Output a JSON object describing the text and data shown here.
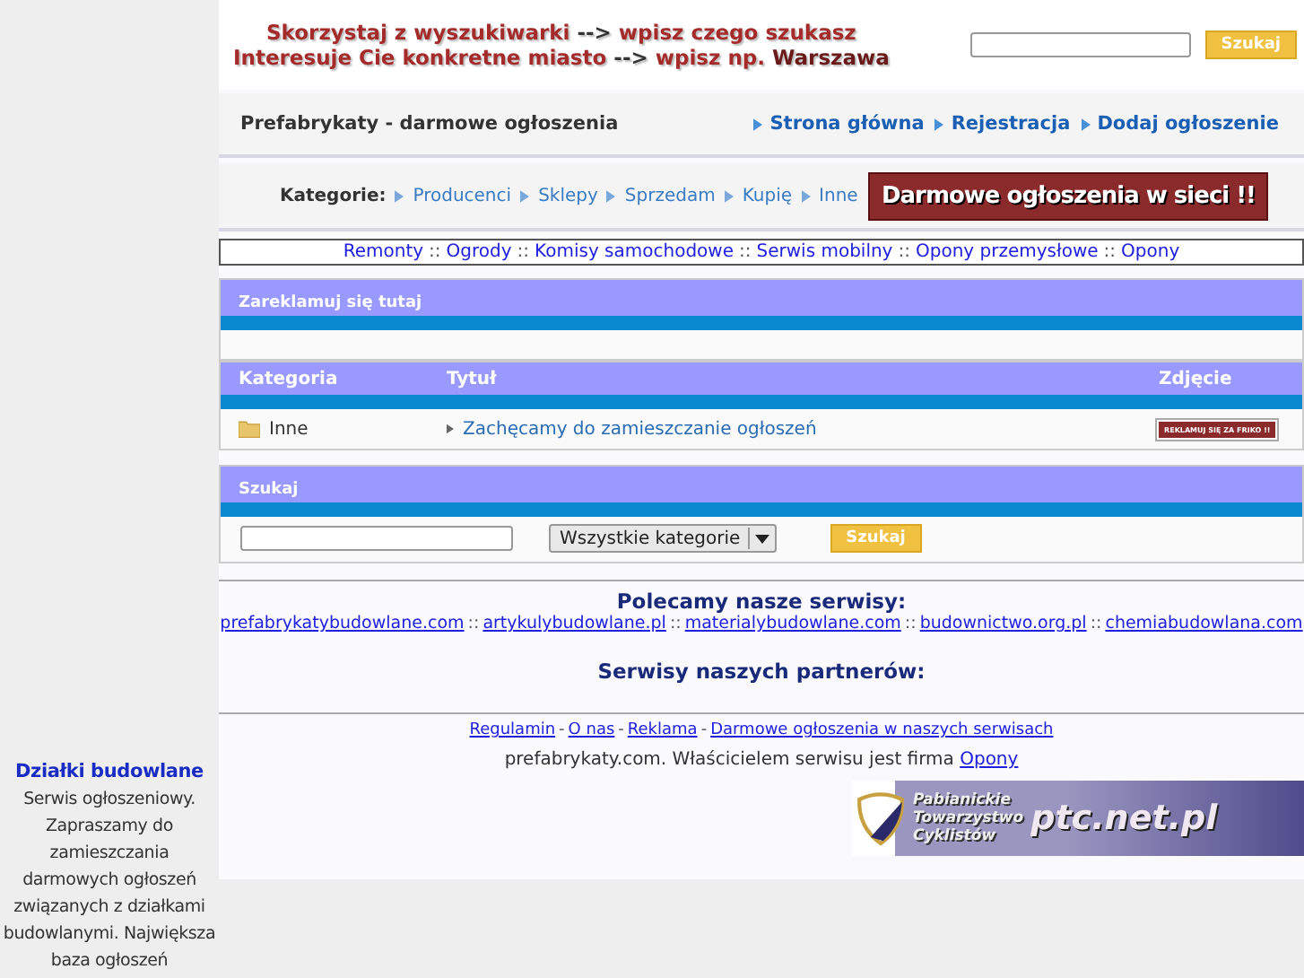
{
  "header": {
    "lines": [
      [
        {
          "text": "Skorzystaj z wyszukiwarki",
          "kind": "red"
        },
        {
          "text": "-->",
          "kind": "dark"
        },
        {
          "text": "wpisz czego szukasz",
          "kind": "red"
        }
      ],
      [
        {
          "text": "Interesuje Cie konkretne miasto",
          "kind": "red"
        },
        {
          "text": "-->",
          "kind": "dark"
        },
        {
          "text": "wpisz np.",
          "kind": "red"
        },
        {
          "text": "Warszawa",
          "kind": "strong"
        }
      ]
    ],
    "search_button": "Szukaj"
  },
  "nav": {
    "title": "Prefabrykaty - darmowe ogłoszenia",
    "links": [
      "Strona główna",
      "Rejestracja",
      "Dodaj ogłoszenie"
    ]
  },
  "categories": {
    "label": "Kategorie:",
    "items": [
      "Producenci",
      "Sklepy",
      "Sprzedam",
      "Kupię",
      "Inne"
    ],
    "banner": "Darmowe ogłoszenia w sieci !!"
  },
  "links_bar_separator": "::",
  "links_bar": [
    "Remonty",
    "Ogrody",
    "Komisy samochodowe",
    "Serwis mobilny",
    "Opony przemysłowe",
    "Opony"
  ],
  "ad_section": {
    "title": "Zareklamuj się tutaj"
  },
  "table": {
    "columns": [
      "Kategoria",
      "Tytuł",
      "Zdjęcie"
    ],
    "rows": [
      {
        "category": "Inne",
        "title": "Zachęcamy do zamieszczanie ogłoszeń",
        "photo_text": "REKLAMUJ SIĘ ZA FRIKO !!"
      }
    ]
  },
  "search": {
    "title": "Szukaj",
    "select": "Wszystkie kategorie",
    "button": "Szukaj"
  },
  "recommended": {
    "title": "Polecamy nasze serwisy:",
    "separator": "::",
    "links": [
      "prefabrykatybudowlane.com",
      "artykulybudowlane.pl",
      "materialybudowlane.com",
      "budownictwo.org.pl",
      "chemiabudowlana.com"
    ]
  },
  "partners": {
    "title": "Serwisy naszych partnerów:"
  },
  "footer": {
    "separator": "-",
    "links": [
      "Regulamin",
      "O nas",
      "Reklama",
      "Darmowe ogłoszenia w naszych serwisach"
    ],
    "owner_text": "prefabrykaty.com. Właścicielem serwisu jest firma",
    "owner_link": "Opony",
    "banner": {
      "lines": [
        "Pabianickie",
        "Towarzystwo",
        "Cyklistów"
      ],
      "domain": "ptc.net.pl"
    }
  },
  "sidebar": {
    "title": "Działki budowlane",
    "text": "Serwis ogłoszeniowy. Zapraszamy do zamieszczania darmowych ogłoszeń związanych z działkami budowlanymi. Największa baza ogłoszeń"
  }
}
